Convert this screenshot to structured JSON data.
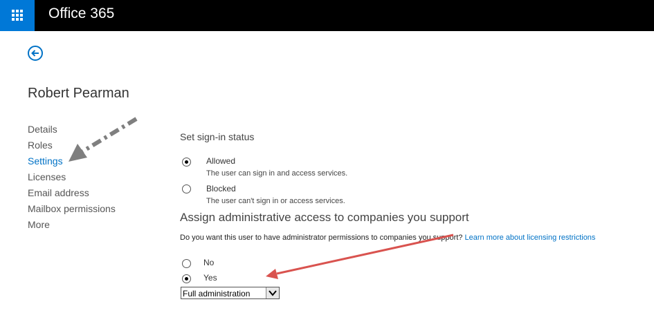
{
  "header": {
    "app_title": "Office 365",
    "app_launcher_icon": "waffle-icon",
    "launcher_color": "#0078d7"
  },
  "back_icon": "back-arrow-icon",
  "user": {
    "name": "Robert Pearman"
  },
  "nav": {
    "items": [
      {
        "label": "Details"
      },
      {
        "label": "Roles"
      },
      {
        "label": "Settings",
        "active": true
      },
      {
        "label": "Licenses"
      },
      {
        "label": "Email address"
      },
      {
        "label": "Mailbox permissions"
      },
      {
        "label": "More"
      }
    ]
  },
  "signin": {
    "title": "Set sign-in status",
    "options": [
      {
        "label": "Allowed",
        "description": "The user can sign in and access services.",
        "checked": true
      },
      {
        "label": "Blocked",
        "description": "The user can't sign in or access services.",
        "checked": false
      }
    ]
  },
  "admin_access": {
    "title": "Assign administrative access to companies you support",
    "question": "Do you want this user to have administrator permissions to companies you support?",
    "link_text": "Learn more about licensing restrictions",
    "options": [
      {
        "label": "No",
        "checked": false
      },
      {
        "label": "Yes",
        "checked": true
      }
    ],
    "select_value": "Full administration"
  },
  "annotations": {
    "gray_arrow_color": "#7f7f7f",
    "red_arrow_color": "#d9534f"
  }
}
